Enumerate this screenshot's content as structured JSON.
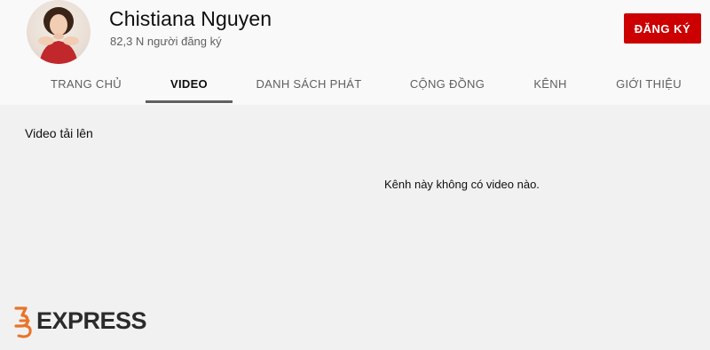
{
  "channel": {
    "name": "Chistiana Nguyen",
    "subscribers": "82,3 N người đăng ký"
  },
  "subscribe_label": "ĐĂNG KÝ",
  "tabs": [
    {
      "label": "TRANG CHỦ",
      "active": false
    },
    {
      "label": "VIDEO",
      "active": true
    },
    {
      "label": "DANH SÁCH PHÁT",
      "active": false
    },
    {
      "label": "CỘNG ĐỒNG",
      "active": false
    },
    {
      "label": "KÊNH",
      "active": false
    },
    {
      "label": "GIỚI THIỆU",
      "active": false
    }
  ],
  "content": {
    "section_title": "Video tải lên",
    "empty_message": "Kênh này không có video nào."
  },
  "watermark": {
    "text": "EXPRESS",
    "logo_icon": "35-logo-icon"
  },
  "colors": {
    "accent": "#cc0000",
    "background": "#f1f1f1",
    "header": "#f9f9f9"
  }
}
